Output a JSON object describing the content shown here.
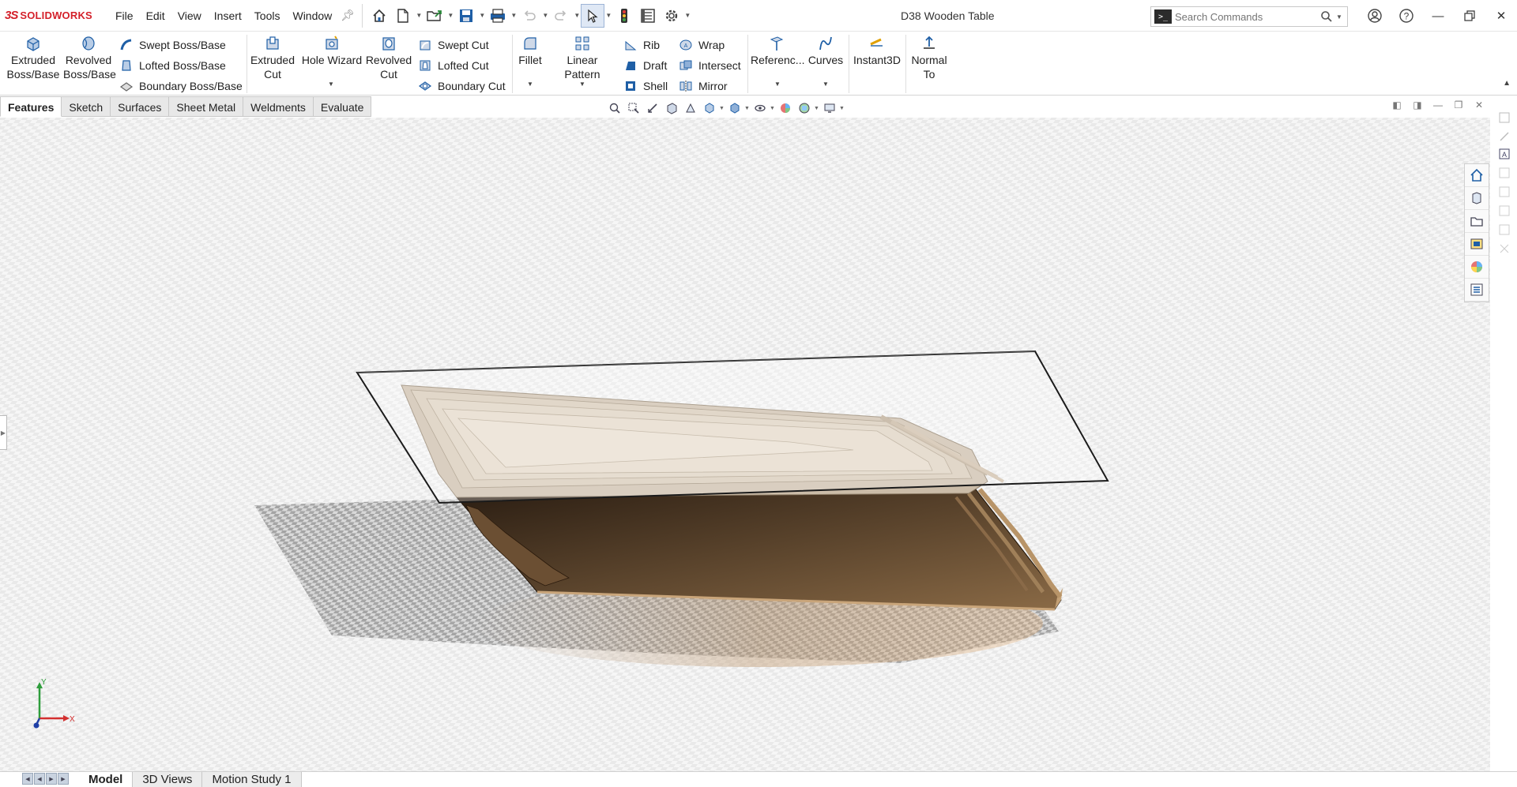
{
  "app": {
    "brand_prefix": "3S",
    "brand_name": "SOLIDWORKS",
    "document_title": "D38 Wooden Table"
  },
  "menu": [
    "File",
    "Edit",
    "View",
    "Insert",
    "Tools",
    "Window"
  ],
  "search": {
    "placeholder": "Search Commands"
  },
  "command_manager": {
    "extruded_boss": "Extruded\nBoss/Base",
    "revolved_boss": "Revolved\nBoss/Base",
    "swept_boss": "Swept Boss/Base",
    "lofted_boss": "Lofted Boss/Base",
    "boundary_boss": "Boundary Boss/Base",
    "extruded_cut": "Extruded\nCut",
    "hole_wizard": "Hole Wizard",
    "revolved_cut": "Revolved\nCut",
    "swept_cut": "Swept Cut",
    "lofted_cut": "Lofted Cut",
    "boundary_cut": "Boundary Cut",
    "fillet": "Fillet",
    "linear_pattern": "Linear Pattern",
    "rib": "Rib",
    "draft": "Draft",
    "shell": "Shell",
    "wrap": "Wrap",
    "intersect": "Intersect",
    "mirror": "Mirror",
    "reference": "Referenc...",
    "curves": "Curves",
    "instant3d": "Instant3D",
    "normal_to": "Normal\nTo"
  },
  "tabs": [
    "Features",
    "Sketch",
    "Surfaces",
    "Sheet Metal",
    "Weldments",
    "Evaluate"
  ],
  "active_tab": "Features",
  "bottom_tabs": [
    "Model",
    "3D Views",
    "Motion Study 1"
  ],
  "active_bottom_tab": "Model",
  "triad": {
    "x_label": "X",
    "y_label": "Y"
  },
  "colors": {
    "brand": "#d4202a",
    "accent": "#1f5fa6",
    "wood_light": "#d9cbb8",
    "wood_dark": "#7a5c3c"
  }
}
